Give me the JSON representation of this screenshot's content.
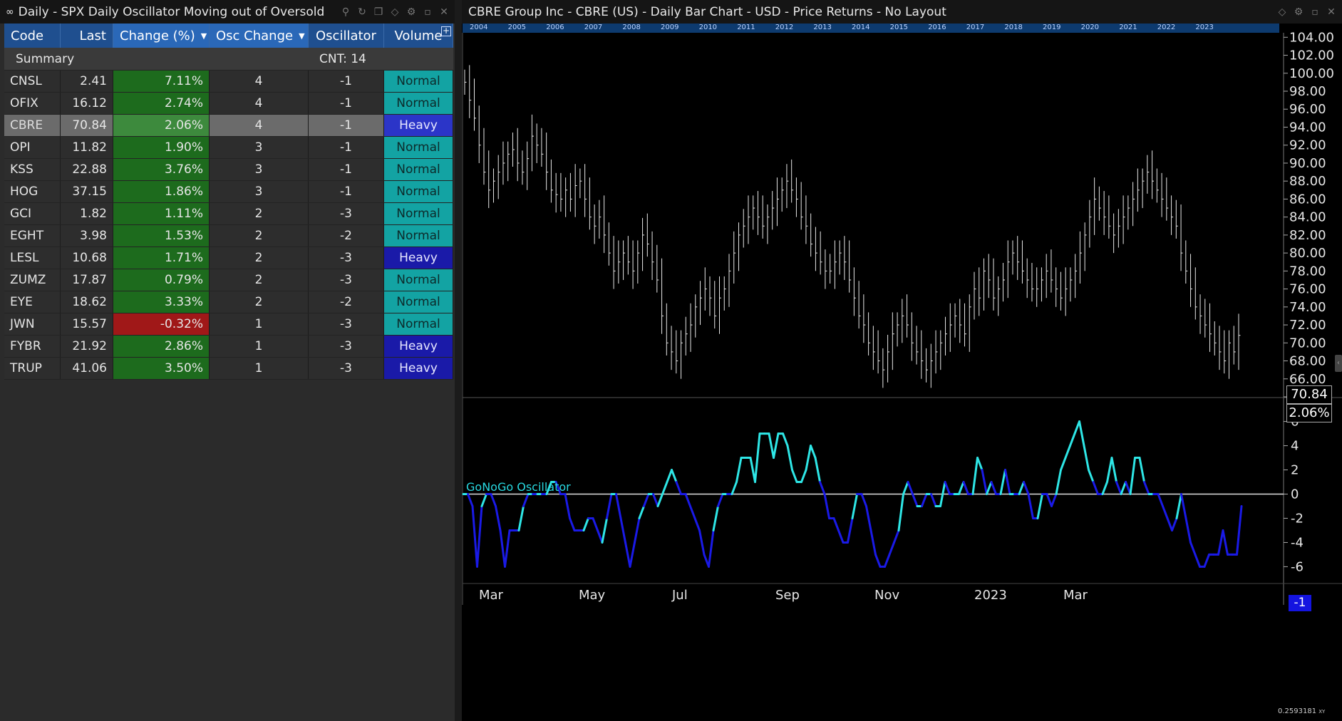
{
  "left_window": {
    "title": "Daily - SPX Daily Oscillator Moving out of Oversold",
    "icons": [
      "link-icon",
      "search-icon",
      "sync-icon",
      "copy-icon",
      "pin-icon",
      "settings-icon",
      "minimize-icon",
      "close-icon"
    ]
  },
  "grid": {
    "columns": {
      "code": "Code",
      "last": "Last",
      "change": "Change (%)",
      "osc_change": "Osc Change",
      "oscillator": "Oscillator",
      "volume": "Volume"
    },
    "summary_label": "Summary",
    "summary_count": "CNT: 14",
    "rows": [
      {
        "code": "CNSL",
        "last": "2.41",
        "change": "7.11%",
        "osc_change": "4",
        "oscillator": "-1",
        "volume": "Normal"
      },
      {
        "code": "OFIX",
        "last": "16.12",
        "change": "2.74%",
        "osc_change": "4",
        "oscillator": "-1",
        "volume": "Normal"
      },
      {
        "code": "CBRE",
        "last": "70.84",
        "change": "2.06%",
        "osc_change": "4",
        "oscillator": "-1",
        "volume": "Heavy"
      },
      {
        "code": "OPI",
        "last": "11.82",
        "change": "1.90%",
        "osc_change": "3",
        "oscillator": "-1",
        "volume": "Normal"
      },
      {
        "code": "KSS",
        "last": "22.88",
        "change": "3.76%",
        "osc_change": "3",
        "oscillator": "-1",
        "volume": "Normal"
      },
      {
        "code": "HOG",
        "last": "37.15",
        "change": "1.86%",
        "osc_change": "3",
        "oscillator": "-1",
        "volume": "Normal"
      },
      {
        "code": "GCI",
        "last": "1.82",
        "change": "1.11%",
        "osc_change": "2",
        "oscillator": "-3",
        "volume": "Normal"
      },
      {
        "code": "EGHT",
        "last": "3.98",
        "change": "1.53%",
        "osc_change": "2",
        "oscillator": "-2",
        "volume": "Normal"
      },
      {
        "code": "LESL",
        "last": "10.68",
        "change": "1.71%",
        "osc_change": "2",
        "oscillator": "-3",
        "volume": "Heavy"
      },
      {
        "code": "ZUMZ",
        "last": "17.87",
        "change": "0.79%",
        "osc_change": "2",
        "oscillator": "-3",
        "volume": "Normal"
      },
      {
        "code": "EYE",
        "last": "18.62",
        "change": "3.33%",
        "osc_change": "2",
        "oscillator": "-2",
        "volume": "Normal"
      },
      {
        "code": "JWN",
        "last": "15.57",
        "change": "-0.32%",
        "osc_change": "1",
        "oscillator": "-3",
        "volume": "Normal"
      },
      {
        "code": "FYBR",
        "last": "21.92",
        "change": "2.86%",
        "osc_change": "1",
        "oscillator": "-3",
        "volume": "Heavy"
      },
      {
        "code": "TRUP",
        "last": "41.06",
        "change": "3.50%",
        "osc_change": "1",
        "oscillator": "-3",
        "volume": "Heavy"
      }
    ],
    "selected_code": "CBRE"
  },
  "right_window": {
    "title": "CBRE Group Inc  - CBRE (US) - Daily Bar Chart - USD - Price Returns - No Layout",
    "icons": [
      "pin-icon",
      "settings-icon",
      "minimize-icon",
      "close-icon"
    ],
    "timeline_years": [
      "2004",
      "2005",
      "2006",
      "2007",
      "2008",
      "2009",
      "2010",
      "2011",
      "2012",
      "2013",
      "2014",
      "2015",
      "2016",
      "2017",
      "2018",
      "2019",
      "2020",
      "2021",
      "2022",
      "2023"
    ],
    "price_label": "70.84",
    "change_label": "2.06%",
    "oscillator_title": "GoNoGo Oscillator",
    "oscillator_value_label": "-1",
    "corner_text": "0.2593181",
    "corner_text_suffix": "XY"
  },
  "colors": {
    "positive": "#1d6b1d",
    "negative": "#a01818",
    "normal_volume": "#13a3a3",
    "heavy_volume": "#1a1aa8",
    "osc_go": "#2ee6e6",
    "osc_nogo": "#1a1ae6"
  },
  "chart_data": [
    {
      "type": "bar",
      "subtype": "ohlc",
      "title": "CBRE Group Inc  - CBRE (US) - Daily Bar Chart - USD - Price Returns - No Layout",
      "y_ticks": [
        "104.00",
        "102.00",
        "100.00",
        "98.00",
        "96.00",
        "94.00",
        "92.00",
        "90.00",
        "88.00",
        "86.00",
        "84.00",
        "82.00",
        "80.00",
        "78.00",
        "76.00",
        "74.00",
        "72.00",
        "70.00",
        "68.00",
        "66.00",
        "64.00"
      ],
      "ylim": [
        64,
        104.5
      ],
      "x_ticks": [
        "Mar",
        "May",
        "Jul",
        "Sep",
        "Nov",
        "2023",
        "Mar"
      ],
      "close_series": [
        99,
        97,
        95,
        92,
        89,
        87,
        88,
        89,
        90,
        91,
        91.5,
        90,
        89,
        90.5,
        93,
        92,
        91,
        89,
        87,
        86.5,
        86,
        87,
        86,
        87.5,
        88,
        86,
        84,
        83,
        84,
        82,
        80,
        78,
        79,
        80,
        79,
        78,
        80,
        82,
        81,
        79,
        77,
        73,
        70,
        69,
        68,
        70,
        71,
        72,
        74,
        75,
        76,
        75,
        73,
        75,
        76,
        78,
        80,
        82,
        83,
        84,
        85,
        84,
        83,
        84,
        85,
        86,
        87,
        88,
        87,
        86,
        84,
        83,
        81,
        80,
        79,
        78,
        78,
        79,
        80,
        79,
        77,
        75,
        73,
        72,
        70,
        69,
        68,
        67,
        69,
        71,
        72,
        73,
        72,
        70,
        69,
        68,
        67,
        68,
        69,
        70,
        71,
        72,
        73,
        72,
        71,
        74,
        76,
        75,
        78,
        77,
        75,
        76,
        77,
        79,
        80,
        79,
        78,
        77,
        76,
        76,
        77,
        78,
        77,
        76,
        75,
        76,
        77,
        78,
        80,
        82,
        84,
        86,
        85,
        84,
        83,
        82,
        83,
        84,
        85,
        86,
        87,
        88,
        89,
        88,
        87,
        86,
        85,
        84,
        83,
        80,
        78,
        76,
        74,
        73,
        72,
        71,
        70,
        69,
        68,
        70,
        69,
        70.84
      ],
      "osc_y_ticks": [
        "6",
        "4",
        "2",
        "0",
        "-2",
        "-4",
        "-6"
      ],
      "osc_ylim": [
        -6.8,
        6.8
      ],
      "oscillator_series": [
        0,
        0,
        -1,
        -6,
        -1,
        0,
        0,
        -1,
        -3,
        -6,
        -3,
        -3,
        -3,
        -1,
        0,
        0,
        0,
        0,
        0,
        1,
        1,
        0,
        0,
        -2,
        -3,
        -3,
        -3,
        -2,
        -2,
        -3,
        -4,
        -2,
        0,
        0,
        -2,
        -4,
        -6,
        -4,
        -2,
        -1,
        0,
        0,
        -1,
        0,
        1,
        2,
        1,
        0,
        0,
        -1,
        -2,
        -3,
        -5,
        -6,
        -3,
        -1,
        0,
        0,
        0,
        1,
        3,
        3,
        3,
        1,
        5,
        5,
        5,
        3,
        5,
        5,
        4,
        2,
        1,
        1,
        2,
        4,
        3,
        1,
        0,
        -2,
        -2,
        -3,
        -4,
        -4,
        -2,
        0,
        0,
        -1,
        -3,
        -5,
        -6,
        -6,
        -5,
        -4,
        -3,
        0,
        1,
        0,
        -1,
        -1,
        0,
        0,
        -1,
        -1,
        1,
        0,
        0,
        0,
        1,
        0,
        0,
        3,
        2,
        0,
        1,
        0,
        0,
        2,
        0,
        0,
        0,
        1,
        0,
        -2,
        -2,
        0,
        0,
        -1,
        0,
        2,
        3,
        4,
        5,
        6,
        4,
        2,
        1,
        0,
        0,
        1,
        3,
        1,
        0,
        1,
        0,
        3,
        3,
        1,
        0,
        0,
        0,
        -1,
        -2,
        -3,
        -2,
        0,
        -2,
        -4,
        -5,
        -6,
        -6,
        -5,
        -5,
        -5,
        -3,
        -5,
        -5,
        -5,
        -1
      ],
      "oscillator_colors": "go/nogo",
      "last_oscillator": -1
    }
  ]
}
